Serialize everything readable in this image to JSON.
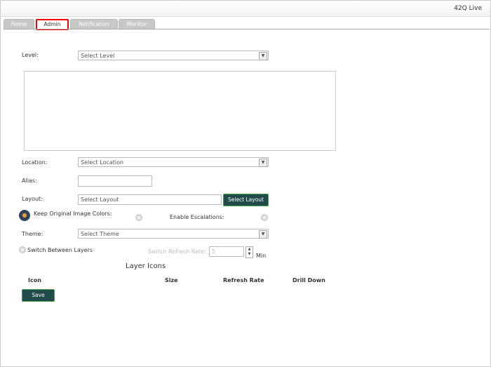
{
  "app": {
    "title": "42Q Live"
  },
  "tabs": [
    {
      "label": "Home"
    },
    {
      "label": "Admin",
      "active": true
    },
    {
      "label": "Notification"
    },
    {
      "label": "Monitor"
    }
  ],
  "form": {
    "level_label": "Level:",
    "level_value": "Select Level",
    "location_label": "Location:",
    "location_value": "Select Location",
    "alias_label": "Alias:",
    "alias_value": "",
    "layout_label": "Layout:",
    "layout_placeholder": "Select Layout",
    "select_layout_button": "Select Layout",
    "keep_colors_label": "Keep Original Image Colors:",
    "enable_escalations_label": "Enable Escalations:",
    "theme_label": "Theme:",
    "theme_value": "Select Theme",
    "switch_layers_label": "Switch Between Layers",
    "switch_rate_label": "Switch Refresh Rate:",
    "switch_rate_value": "5",
    "switch_rate_unit": "Min"
  },
  "layer_icons": {
    "title": "Layer Icons",
    "columns": [
      "Icon",
      "Size",
      "Refresh Rate",
      "Drill Down"
    ]
  },
  "save_button": "Save"
}
